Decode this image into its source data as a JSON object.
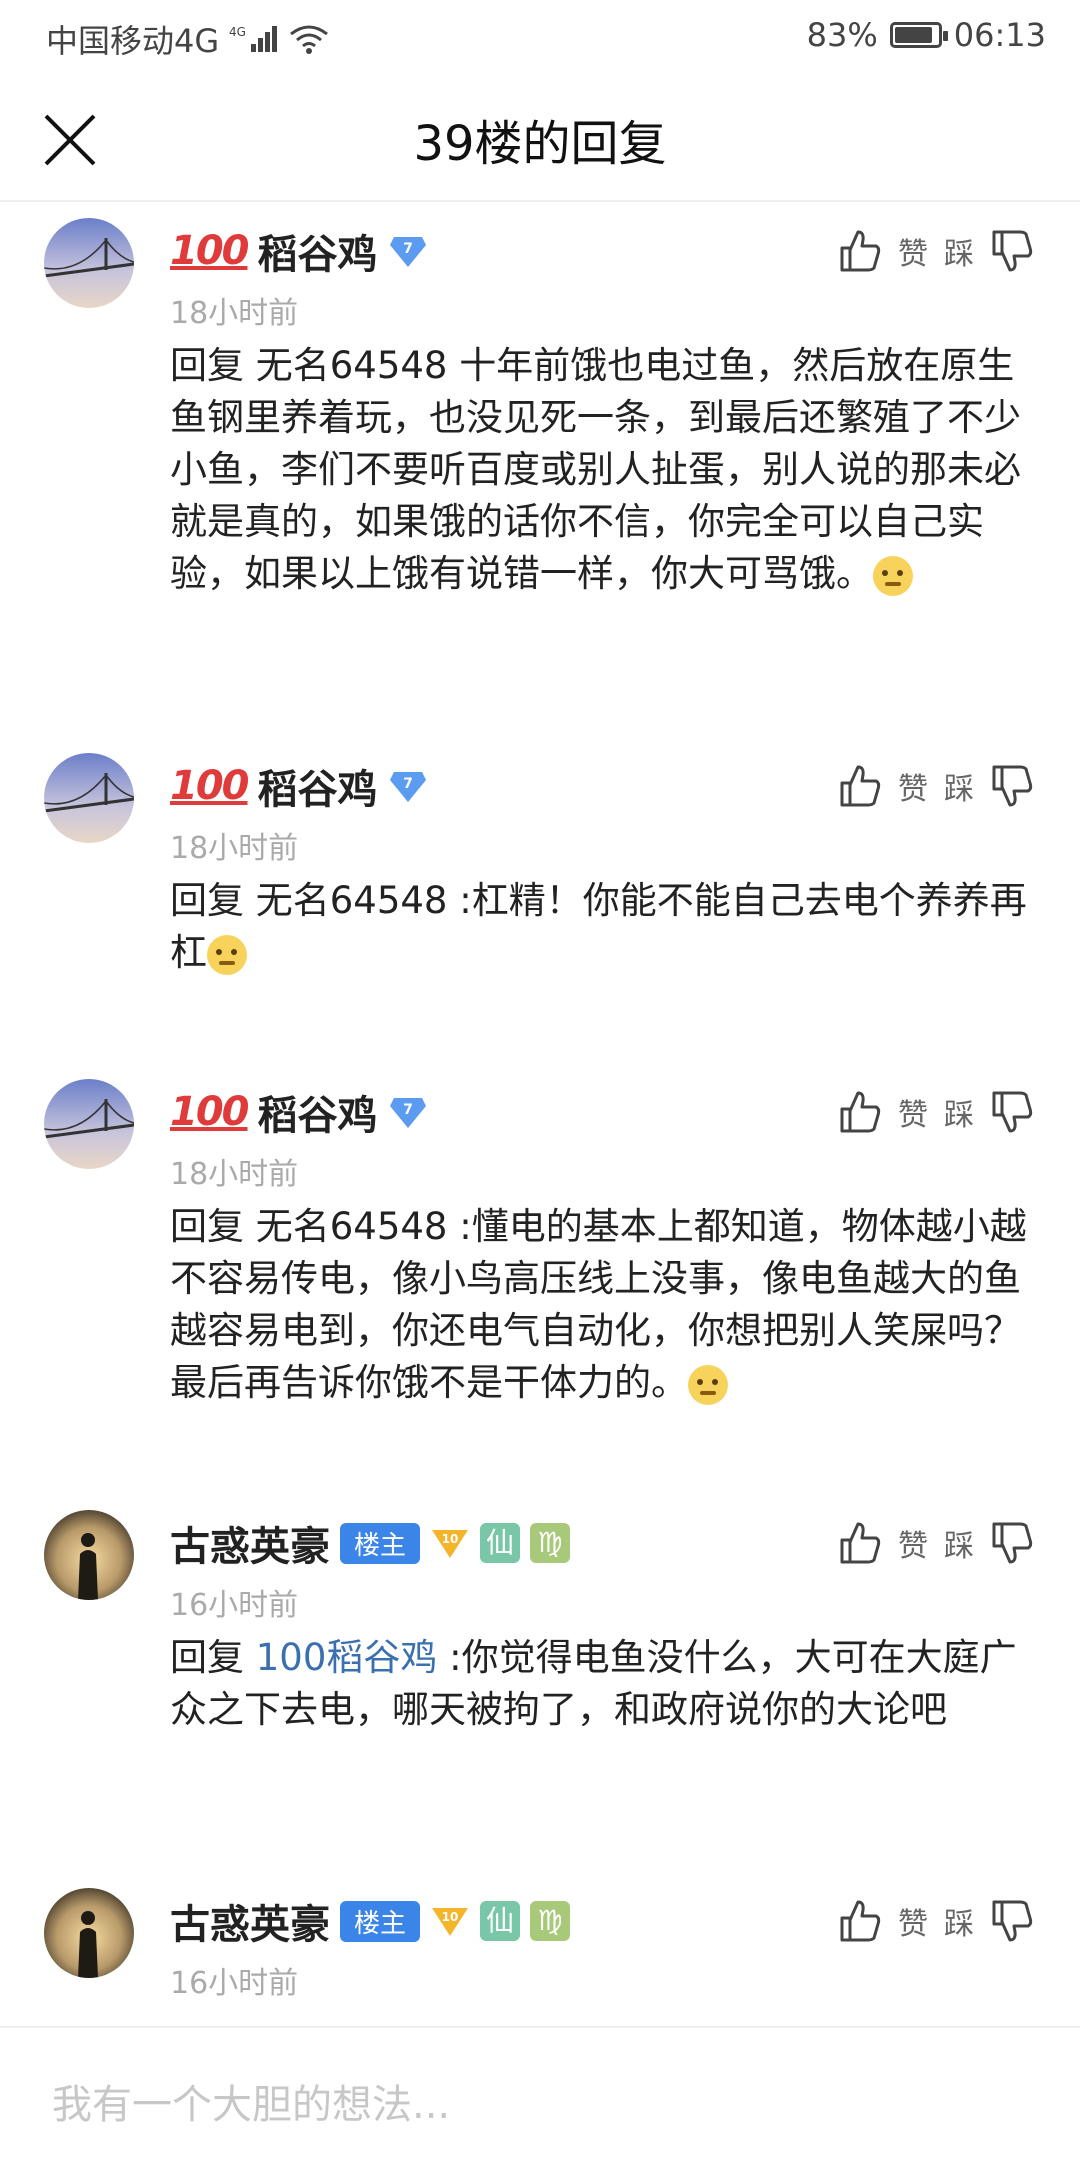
{
  "status": {
    "carrier": "中国移动4G",
    "net": "4G",
    "battery": "83%",
    "time": "06:13"
  },
  "header": {
    "title": "39楼的回复"
  },
  "posts": [
    {
      "user": "稻谷鸡",
      "badge_emoji": "100",
      "vip_level": "7",
      "time": "18小时前",
      "text": "回复 无名64548 十年前饿也电过鱼，然后放在原生鱼钢里养着玩，也没见死一条，到最后还繁殖了不少小鱼，李们不要听百度或别人扯蛋，别人说的那未必就是真的，如果饿的话你不信，你完全可以自己实验，如果以上饿有说错一样，你大可骂饿。",
      "like": "赞",
      "dislike": "踩"
    },
    {
      "user": "稻谷鸡",
      "badge_emoji": "100",
      "vip_level": "7",
      "time": "18小时前",
      "text": "回复 无名64548 :杠精！你能不能自己去电个养养再杠",
      "like": "赞",
      "dislike": "踩"
    },
    {
      "user": "稻谷鸡",
      "badge_emoji": "100",
      "vip_level": "7",
      "time": "18小时前",
      "text": "回复 无名64548 :懂电的基本上都知道，物体越小越不容易传电，像小鸟高压线上没事，像电鱼越大的鱼越容易电到，你还电气自动化，你想把别人笑屎吗？最后再告诉你饿不是干体力的。",
      "like": "赞",
      "dislike": "踩"
    },
    {
      "user": "古惑英豪",
      "host_badge": "楼主",
      "level": "10",
      "tag1": "仙",
      "tag2": "♍",
      "time": "16小时前",
      "reply_prefix": "回复",
      "mention": "100稻谷鸡",
      "text": ":你觉得电鱼没什么，大可在大庭广众之下去电，哪天被拘了，和政府说你的大论吧",
      "like": "赞",
      "dislike": "踩"
    },
    {
      "user": "古惑英豪",
      "host_badge": "楼主",
      "level": "10",
      "tag1": "仙",
      "tag2": "♍",
      "time": "16小时前",
      "like": "赞",
      "dislike": "踩"
    }
  ],
  "input": {
    "placeholder": "我有一个大胆的想法..."
  }
}
